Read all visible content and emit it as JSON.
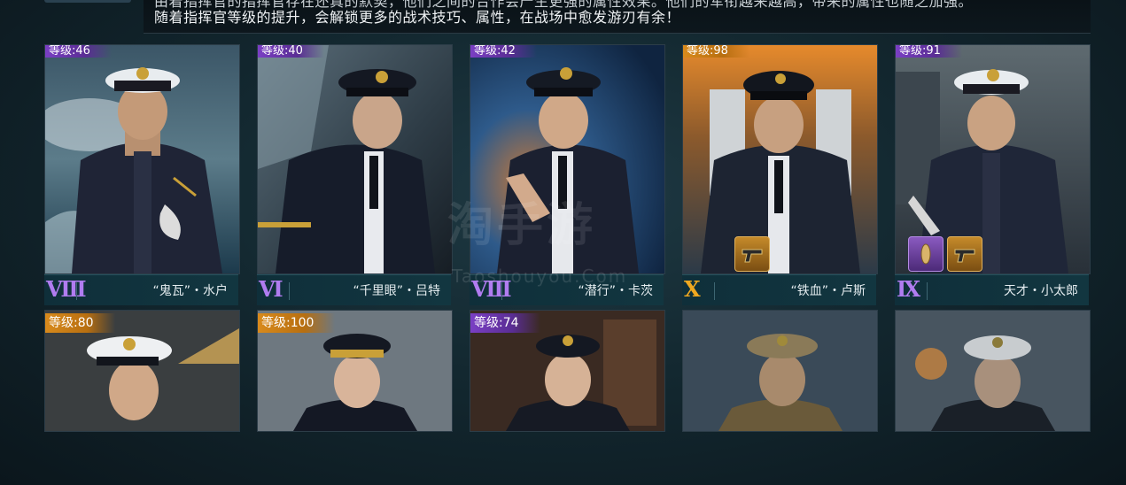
{
  "description": {
    "line1": "由着指挥官的指挥官存在还真的默契，他们之间的合作会产生更强的属性效果。他们的军衔越来越高，带来的属性也随之加强。",
    "line2": "随着指挥官等级的提升，会解锁更多的战术技巧、属性，在战场中愈发游刃有余！"
  },
  "captains": [
    {
      "level": "等级:46",
      "rank": "Ⅷ",
      "rank_color": "purple",
      "name": "“鬼瓦”・水户",
      "badge_color": "purple"
    },
    {
      "level": "等级:40",
      "rank": "Ⅵ",
      "rank_color": "purple",
      "name": "“千里眼”・吕特",
      "badge_color": "purple"
    },
    {
      "level": "等级:42",
      "rank": "Ⅷ",
      "rank_color": "purple",
      "name": "“潜行”・卡茨",
      "badge_color": "purple"
    },
    {
      "level": "等级:98",
      "rank": "Ⅹ",
      "rank_color": "gold",
      "name": "“铁血”・卢斯",
      "badge_color": "gold",
      "items": [
        "pistol-icon"
      ]
    },
    {
      "level": "等级:91",
      "rank": "Ⅸ",
      "rank_color": "purple",
      "name": "天才・小太郎",
      "badge_color": "purple",
      "items": [
        "amulet-icon",
        "pistol-icon"
      ]
    }
  ],
  "captains_row2": [
    {
      "level": "等级:80",
      "badge_color": "gold"
    },
    {
      "level": "等级:100",
      "badge_color": "gold"
    },
    {
      "level": "等级:74",
      "badge_color": "purple"
    },
    {
      "level": "",
      "badge_color": "none"
    },
    {
      "level": "",
      "badge_color": "none"
    }
  ],
  "watermark": {
    "main": "淘手游",
    "sub": "Taoshouyou.Com"
  },
  "colors": {
    "purple": "#b07cf0",
    "gold": "#f0a820",
    "panel": "#123640"
  }
}
